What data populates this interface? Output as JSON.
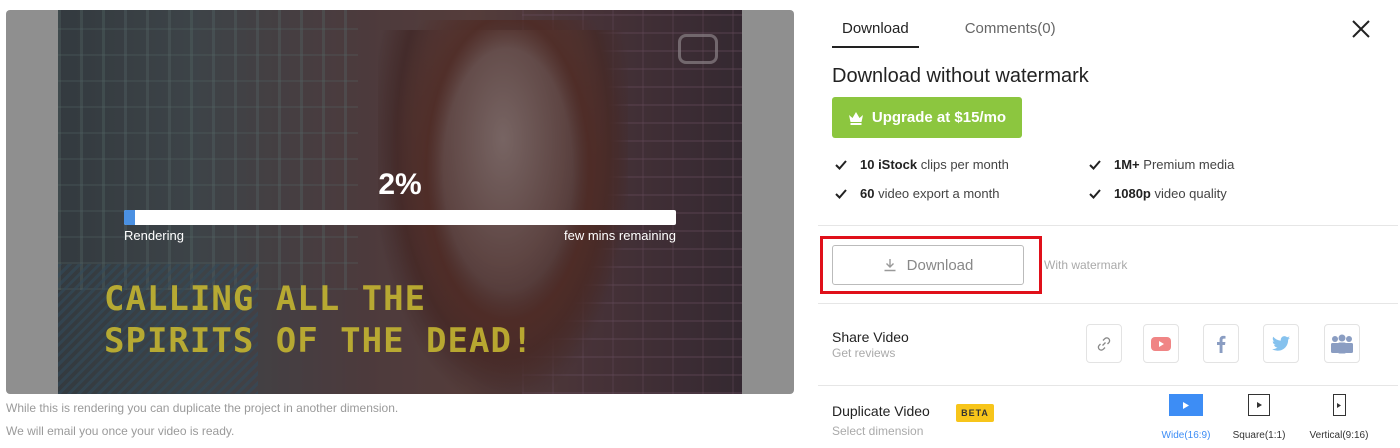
{
  "preview": {
    "overlay_text": "CALLING ALL THE\nSPIRITS OF THE DEAD!",
    "progress_percent_label": "2%",
    "progress_fraction": 0.02,
    "status_left": "Rendering",
    "status_right": "few mins remaining",
    "hint_line1": "While this is rendering you can duplicate the project in another dimension.",
    "hint_line2": "We will email you once your video is ready."
  },
  "tabs": [
    {
      "label": "Download",
      "active": true
    },
    {
      "label": "Comments(0)",
      "active": false
    }
  ],
  "download_panel": {
    "heading": "Download without watermark",
    "upgrade_label": "Upgrade at $15/mo",
    "upgrade_color": "#8cc63f",
    "features": [
      {
        "bold": "10 iStock",
        "rest": " clips per month"
      },
      {
        "bold": "1M+",
        "rest": " Premium media"
      },
      {
        "bold": "60",
        "rest": " video export a month"
      },
      {
        "bold": "1080p",
        "rest": " video quality"
      }
    ],
    "download_label": "Download",
    "download_note": "With watermark",
    "highlight_color": "#e0101a"
  },
  "share": {
    "title": "Share Video",
    "subtitle": "Get reviews",
    "buttons": [
      "link-icon",
      "youtube-icon",
      "facebook-icon",
      "twitter-icon",
      "team-icon"
    ]
  },
  "duplicate": {
    "title": "Duplicate Video",
    "badge": "BETA",
    "subtitle": "Select dimension",
    "options": [
      {
        "label": "Wide(16:9)",
        "active": true
      },
      {
        "label": "Square(1:1)",
        "active": false
      },
      {
        "label": "Vertical(9:16)",
        "active": false
      }
    ],
    "accent_color": "#3d8df5"
  }
}
